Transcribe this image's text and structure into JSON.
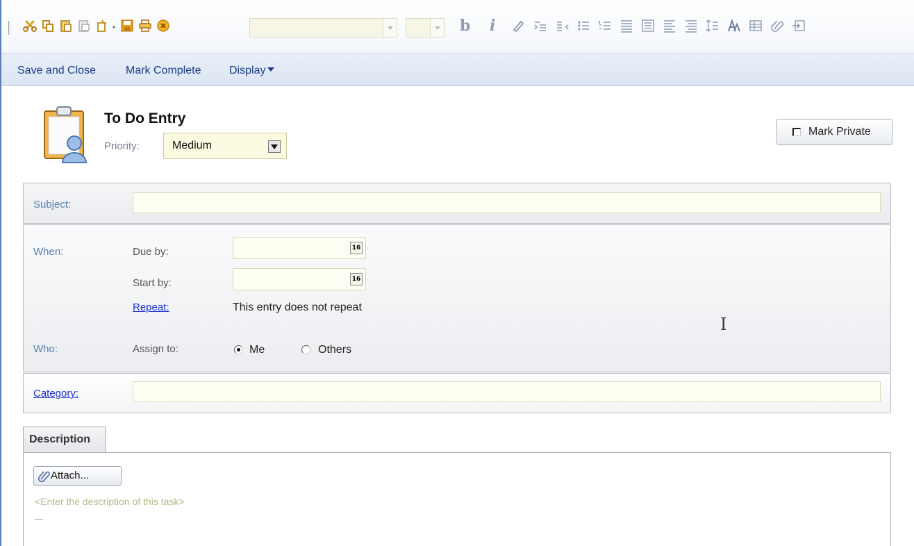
{
  "actions": {
    "save_close": "Save and Close",
    "mark_complete": "Mark Complete",
    "display": "Display"
  },
  "header": {
    "title": "To Do Entry",
    "priority_label": "Priority:",
    "priority_value": "Medium",
    "mark_private": "Mark Private",
    "mark_private_checked": false
  },
  "subject": {
    "label": "Subject:",
    "value": ""
  },
  "when": {
    "label": "When:",
    "due_by_label": "Due by:",
    "due_by_value": "",
    "start_by_label": "Start by:",
    "start_by_value": "",
    "calendar_glyph": "16",
    "repeat_link": "Repeat:",
    "repeat_text": "This entry does not repeat"
  },
  "who": {
    "label": "Who:",
    "assign_label": "Assign to:",
    "options": [
      "Me",
      "Others"
    ],
    "selected": "Me"
  },
  "category": {
    "link": "Category:",
    "value": ""
  },
  "description": {
    "tab": "Description",
    "attach": "Attach...",
    "placeholder": "<Enter the description of this task>"
  },
  "toolbar": {
    "icons": [
      "cut-icon",
      "copy-icon",
      "paste-icon",
      "paste-special-icon",
      "new-icon",
      "save-icon",
      "print-icon",
      "close-icon",
      "bold-icon",
      "italic-icon",
      "highlight-icon",
      "indent-icon",
      "outdent-icon",
      "bullet-list-icon",
      "numbered-list-icon",
      "align-left-icon",
      "align-center-icon",
      "align-right-icon",
      "justify-icon",
      "line-spacing-icon",
      "text-style-icon",
      "table-icon",
      "link-icon",
      "insert-icon"
    ]
  }
}
